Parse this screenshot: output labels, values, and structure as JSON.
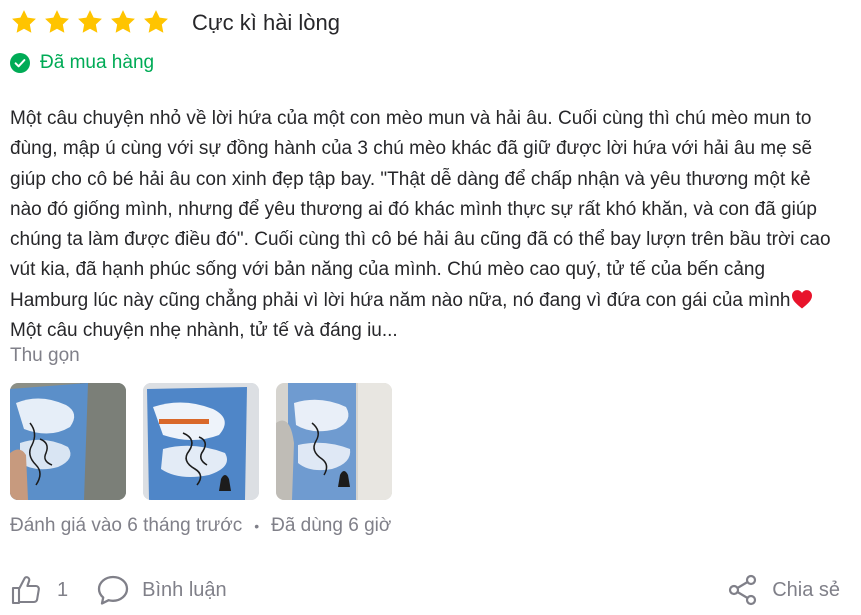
{
  "review": {
    "rating": 5,
    "rating_max": 5,
    "star_color": "#ffc400",
    "rating_title": "Cực kì hài lòng",
    "verified_label": "Đã mua hàng",
    "verified_color": "#00ab56",
    "text_part1": "Một câu chuyện nhỏ về lời hứa của một con mèo mun và hải âu. Cuối cùng thì chú mèo mun to đùng, mập ú cùng với sự đồng hành của 3 chú mèo khác đã giữ được lời hứa với hải âu mẹ sẽ giúp cho cô bé hải âu con xinh đẹp tập bay. \"Thật dễ dàng để chấp nhận và yêu thương một kẻ nào đó giống mình, nhưng để yêu thương ai đó khác mình thực sự rất khó khăn, và con đã giúp chúng ta làm được điều đó\". Cuối cùng thì cô bé hải âu cũng đã có thể bay lượn trên bầu trời cao vút kia, đã hạnh phúc sống với bản năng của mình. Chú mèo cao quý, tử tế của bến cảng Hamburg lúc này cũng chẳng phải vì lời hứa năm nào nữa, nó đang vì đứa con gái của mình",
    "text_part2": " Một câu chuyện nhẹ nhành, tử tế và đáng iu...",
    "collapse_label": "Thu gọn",
    "photos": [
      {
        "name": "review-photo-1"
      },
      {
        "name": "review-photo-2"
      },
      {
        "name": "review-photo-3"
      }
    ],
    "reviewed_time": "Đánh giá vào 6 tháng trước",
    "meta_separator": "•",
    "usage_time": "Đã dùng 6 giờ"
  },
  "actions": {
    "like_count": "1",
    "comment_label": "Bình luận",
    "share_label": "Chia sẻ"
  },
  "icons": {
    "star": "star-icon",
    "verified": "check-circle-icon",
    "heart": "heart-emoji-icon",
    "like": "thumbs-up-icon",
    "comment": "comment-bubble-icon",
    "share": "share-icon"
  }
}
